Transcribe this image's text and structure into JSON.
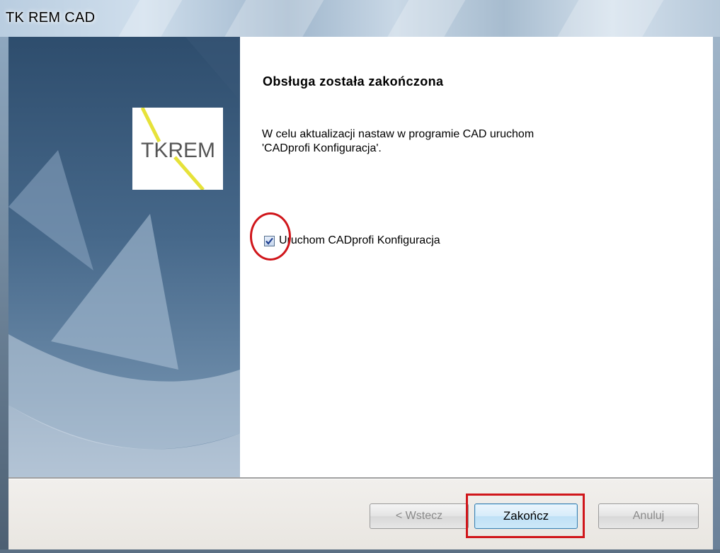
{
  "window": {
    "title": "TK REM CAD"
  },
  "logo": {
    "text": "TKREM"
  },
  "content": {
    "heading": "Obsługa została zakończona",
    "description_lines": [
      "W celu aktualizacji nastaw w programie CAD uruchom",
      "'CADprofi Konfiguracja'."
    ],
    "checkbox": {
      "label": "Uruchom CADprofi Konfiguracja",
      "checked": true
    }
  },
  "buttons": {
    "back_label": "< Wstecz",
    "finish_label": "Zakończ",
    "cancel_label": "Anuluj"
  },
  "colors": {
    "highlight": "#d0161b",
    "logo_accent": "#e6e23a"
  }
}
